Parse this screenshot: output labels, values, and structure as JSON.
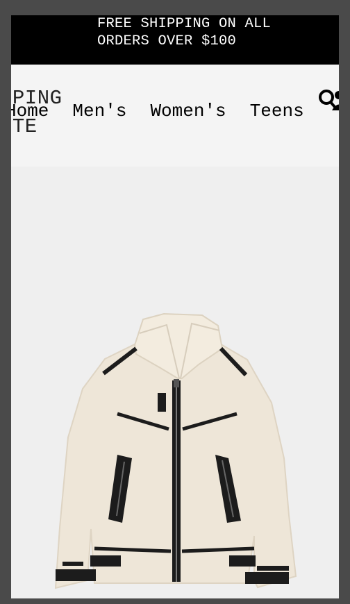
{
  "promo": {
    "text": "FREE SHIPPING ON ALL\nORDERS OVER $100"
  },
  "header": {
    "brand": "PPING\nITE",
    "nav": [
      {
        "label": "Home"
      },
      {
        "label": "Men's"
      },
      {
        "label": "Women's"
      },
      {
        "label": "Teens"
      }
    ],
    "icons": [
      "search-icon",
      "user-icon"
    ]
  },
  "product": {
    "image_icon": "shearling-jacket-image",
    "colors": {
      "fleece": "#efe6d8",
      "trim": "#1c1c1c"
    }
  }
}
